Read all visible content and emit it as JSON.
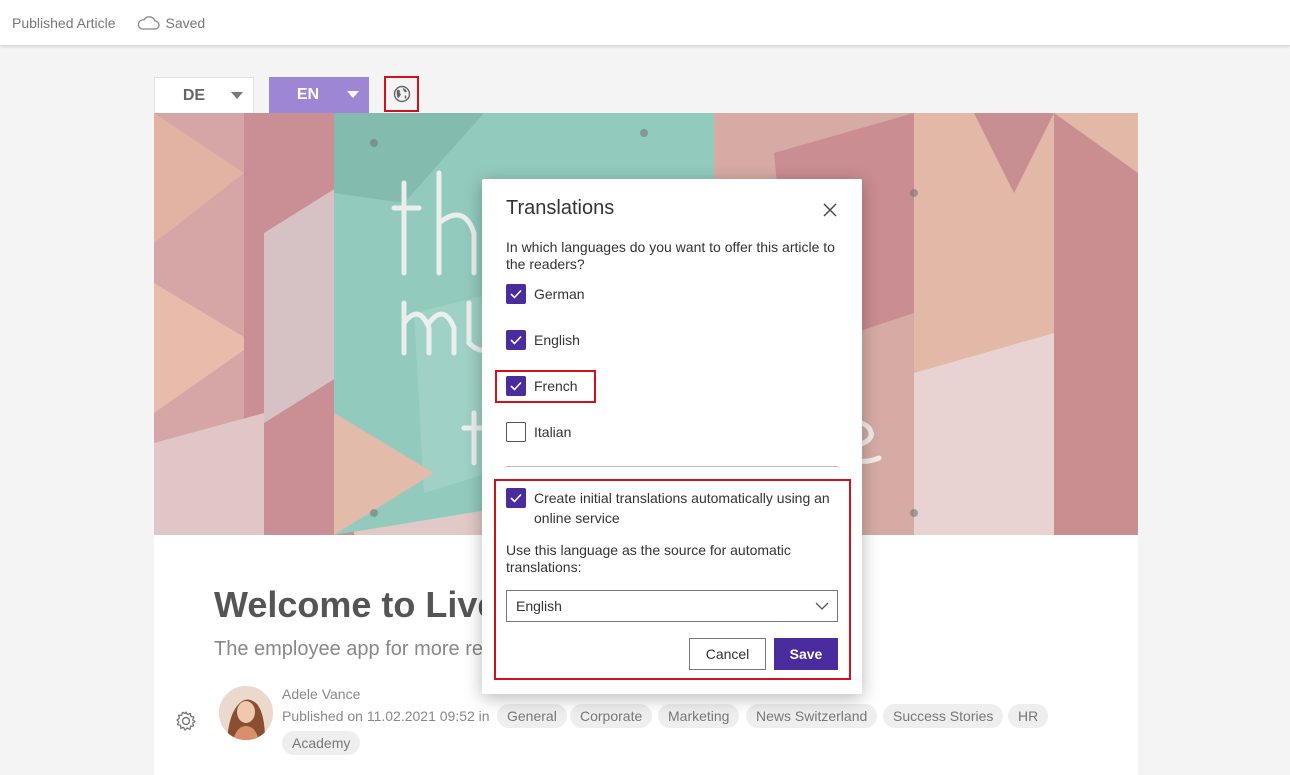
{
  "topbar": {
    "status": "Published Article",
    "saved": "Saved"
  },
  "language_tabs": [
    {
      "code": "DE"
    },
    {
      "code": "EN"
    }
  ],
  "article": {
    "title": "Welcome to LiveTiles",
    "subtitle": "The employee app for more reach",
    "author": "Adele Vance",
    "published": "Published on 11.02.2021 09:52 in",
    "tags": [
      "General",
      "Corporate",
      "Marketing",
      "News Switzerland",
      "Success Stories",
      "HR",
      "Academy"
    ]
  },
  "dialog": {
    "title": "Translations",
    "question": "In which languages do you want to offer this article to the readers?",
    "languages": [
      {
        "label": "German",
        "checked": true
      },
      {
        "label": "English",
        "checked": true
      },
      {
        "label": "French",
        "checked": true
      },
      {
        "label": "Italian",
        "checked": false
      }
    ],
    "auto_translate_label": "Create initial translations automatically using an online service",
    "auto_translate_checked": true,
    "source_label": "Use this language as the source for automatic translations:",
    "source_value": "English",
    "cancel_label": "Cancel",
    "save_label": "Save"
  },
  "colors": {
    "accent": "#4a2c9e",
    "tab_active": "#9d86d3",
    "highlight": "#d0121f"
  }
}
